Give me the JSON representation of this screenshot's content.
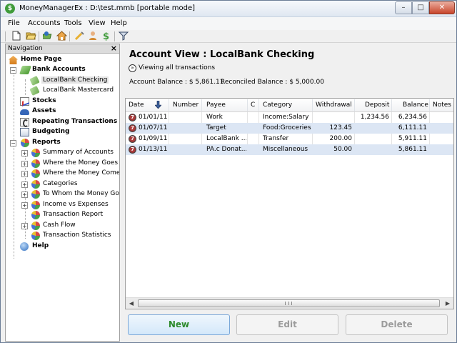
{
  "window": {
    "title": "MoneyManagerEx : D:\\test.mmb [portable mode]",
    "app_icon": "$"
  },
  "menu": [
    "File",
    "Accounts",
    "Tools",
    "View",
    "Help"
  ],
  "toolbar": {
    "icons": [
      "new-file-icon",
      "open-folder-icon",
      "new-account-icon",
      "home-icon",
      "options-icon",
      "users-icon",
      "dollar-icon",
      "filter-icon"
    ]
  },
  "navigation": {
    "title": "Navigation",
    "close": "×",
    "items": [
      {
        "label": "Home Page",
        "bold": true
      },
      {
        "label": "Bank Accounts",
        "bold": true
      },
      {
        "label": "LocalBank Checking",
        "bold": false
      },
      {
        "label": "LocalBank Mastercard",
        "bold": false
      },
      {
        "label": "Stocks",
        "bold": true
      },
      {
        "label": "Assets",
        "bold": true
      },
      {
        "label": "Repeating Transactions",
        "bold": true
      },
      {
        "label": "Budgeting",
        "bold": true
      },
      {
        "label": "Reports",
        "bold": true
      },
      {
        "label": "Summary of Accounts",
        "bold": false
      },
      {
        "label": "Where the Money Goes",
        "bold": false
      },
      {
        "label": "Where the Money Comes",
        "bold": false
      },
      {
        "label": "Categories",
        "bold": false
      },
      {
        "label": "To Whom the Money Goe",
        "bold": false
      },
      {
        "label": "Income vs Expenses",
        "bold": false
      },
      {
        "label": "Transaction Report",
        "bold": false
      },
      {
        "label": "Cash Flow",
        "bold": false
      },
      {
        "label": "Transaction Statistics",
        "bold": false
      },
      {
        "label": "Help",
        "bold": true
      }
    ]
  },
  "account": {
    "title": "Account View : LocalBank Checking",
    "filter_label": "Viewing all transactions",
    "account_balance": "Account Balance : $ 5,861.11",
    "reconciled_balance": "Reconciled Balance : $ 5,000.00"
  },
  "grid": {
    "columns": [
      "Date",
      "Number",
      "Payee",
      "C",
      "Category",
      "Withdrawal",
      "Deposit",
      "Balance",
      "Notes"
    ],
    "rows": [
      {
        "date": "01/01/11",
        "number": "",
        "payee": "Work",
        "status": "",
        "category": "Income:Salary",
        "withdrawal": "",
        "deposit": "1,234.56",
        "balance": "6,234.56",
        "notes": ""
      },
      {
        "date": "01/07/11",
        "number": "",
        "payee": "Target",
        "status": "",
        "category": "Food:Groceries",
        "withdrawal": "123.45",
        "deposit": "",
        "balance": "6,111.11",
        "notes": ""
      },
      {
        "date": "01/09/11",
        "number": "",
        "payee": "LocalBank ...",
        "status": "",
        "category": "Transfer",
        "withdrawal": "200.00",
        "deposit": "",
        "balance": "5,911.11",
        "notes": ""
      },
      {
        "date": "01/13/11",
        "number": "",
        "payee": "PA.c Donat...",
        "status": "",
        "category": "Miscellaneous",
        "withdrawal": "50.00",
        "deposit": "",
        "balance": "5,861.11",
        "notes": ""
      }
    ]
  },
  "buttons": {
    "new": "New",
    "edit": "Edit",
    "delete": "Delete"
  },
  "colors": {
    "row_alt": "#dce6f4",
    "new_text": "#2e8b2e"
  }
}
